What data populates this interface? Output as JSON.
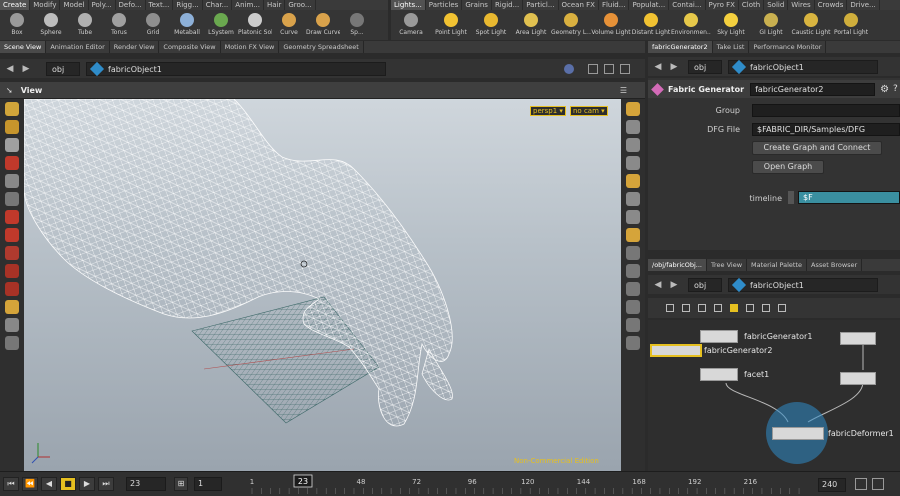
{
  "shelf_left": {
    "tabs": [
      "Create",
      "Modify",
      "Model",
      "Poly...",
      "Defo...",
      "Text...",
      "Rigg...",
      "Char...",
      "Anim...",
      "Hair",
      "Groo..."
    ],
    "tools": [
      {
        "label": "Box",
        "icon": "box-icon",
        "color": "#9a9a9a"
      },
      {
        "label": "Sphere",
        "icon": "sphere-icon",
        "color": "#bdbdbd"
      },
      {
        "label": "Tube",
        "icon": "tube-icon",
        "color": "#b0b0b0"
      },
      {
        "label": "Torus",
        "icon": "torus-icon",
        "color": "#a0a0a0"
      },
      {
        "label": "Grid",
        "icon": "grid-icon",
        "color": "#8f8f8f"
      },
      {
        "label": "Metaball",
        "icon": "metaball-icon",
        "color": "#8db0d8"
      },
      {
        "label": "LSystem",
        "icon": "lsystem-icon",
        "color": "#6aa84f"
      },
      {
        "label": "Platonic Sol...",
        "icon": "platonic-icon",
        "color": "#cccccc"
      },
      {
        "label": "Curve",
        "icon": "curve-icon",
        "color": "#d9a24b"
      },
      {
        "label": "Draw Curve",
        "icon": "draw-curve-icon",
        "color": "#d9a24b"
      },
      {
        "label": "Sp...",
        "icon": "spray-icon",
        "color": "#777777"
      }
    ]
  },
  "shelf_right": {
    "tabs": [
      "Lights...",
      "Particles",
      "Grains",
      "Rigid...",
      "Particl...",
      "Ocean FX",
      "Fluid...",
      "Populat...",
      "Contai...",
      "Pyro FX",
      "Cloth",
      "Solid",
      "Wires",
      "Crowds",
      "Drive..."
    ],
    "tools": [
      {
        "label": "Camera",
        "icon": "camera-icon",
        "color": "#9a9a9a"
      },
      {
        "label": "Point Light",
        "icon": "point-light-icon",
        "color": "#f1c232"
      },
      {
        "label": "Spot Light",
        "icon": "spot-light-icon",
        "color": "#e8b830"
      },
      {
        "label": "Area Light",
        "icon": "area-light-icon",
        "color": "#e0c050"
      },
      {
        "label": "Geometry L...",
        "icon": "geometry-light-icon",
        "color": "#d9b040"
      },
      {
        "label": "Volume Light",
        "icon": "volume-light-icon",
        "color": "#e69138"
      },
      {
        "label": "Distant Light",
        "icon": "distant-light-icon",
        "color": "#f1c232"
      },
      {
        "label": "Environmen...",
        "icon": "environment-light-icon",
        "color": "#e6c84a"
      },
      {
        "label": "Sky Light",
        "icon": "sky-light-icon",
        "color": "#f4d03f"
      },
      {
        "label": "GI Light",
        "icon": "gi-light-icon",
        "color": "#c9b050"
      },
      {
        "label": "Caustic Light",
        "icon": "caustic-light-icon",
        "color": "#d8b440"
      },
      {
        "label": "Portal Light",
        "icon": "portal-light-icon",
        "color": "#cfae3c"
      }
    ]
  },
  "left_pane": {
    "tabs": [
      "Scene View",
      "Animation Editor",
      "Render View",
      "Composite View",
      "Motion FX View",
      "Geometry Spreadsheet"
    ],
    "path_root": "obj",
    "path_node": "fabricObject1",
    "viewport_title": "View",
    "persp_label": "persp1",
    "cam_label": "no cam",
    "watermark": "Non-Commercial Edition"
  },
  "param_pane": {
    "tabs": [
      "fabricGenerator2",
      "Take List",
      "Performance Monitor"
    ],
    "path_root": "obj",
    "path_node": "fabricObject1",
    "node_type": "Fabric Generator",
    "node_name": "fabricGenerator2",
    "group_label": "Group",
    "group_value": "",
    "dfg_label": "DFG File",
    "dfg_value": "$FABRIC_DIR/Samples/DFG",
    "create_button": "Create Graph and Connect",
    "open_button": "Open Graph",
    "timeline_label": "timeline",
    "timeline_value": "$F"
  },
  "network_pane": {
    "tabs": [
      "/obj/fabricObj...",
      "Tree View",
      "Material Palette",
      "Asset Browser"
    ],
    "path_root": "obj",
    "path_node": "fabricObject1",
    "nodes": [
      "fabricGenerator1",
      "fabricGenerator2",
      "facet1",
      "fabricDeformer1"
    ]
  },
  "timeline": {
    "current_frame": "23",
    "start_frame": "1",
    "step": "1",
    "end_frame": "240",
    "ticks": [
      "1",
      "23",
      "48",
      "72",
      "96",
      "120",
      "144",
      "168",
      "192",
      "216"
    ],
    "tick_values": [
      1,
      23,
      48,
      72,
      96,
      120,
      144,
      168,
      192,
      216
    ],
    "range": [
      1,
      240
    ]
  },
  "colors": {
    "accent_blue": "#2f8cc9",
    "selected_yellow": "#e6c020",
    "timeline_param": "#3a8fa0",
    "node_pink": "#d46bb8"
  }
}
